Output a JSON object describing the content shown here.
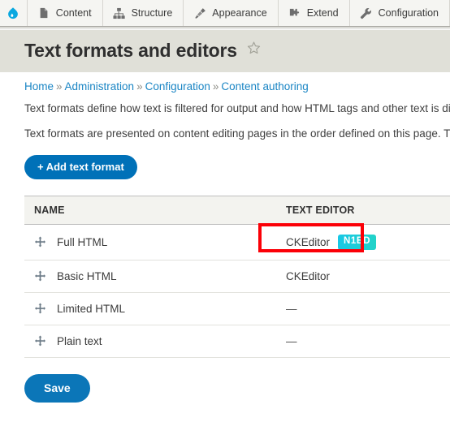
{
  "toolbar": {
    "home_icon": "drupal-droplet-logo",
    "tabs": [
      {
        "label": "Content",
        "icon": "document-icon"
      },
      {
        "label": "Structure",
        "icon": "hierarchy-icon"
      },
      {
        "label": "Appearance",
        "icon": "paintbrush-icon"
      },
      {
        "label": "Extend",
        "icon": "puzzle-piece-icon"
      },
      {
        "label": "Configuration",
        "icon": "wrench-icon"
      }
    ]
  },
  "header": {
    "title": "Text formats and editors",
    "bookmark_icon": "star-outline-icon"
  },
  "breadcrumb": {
    "separator": "»",
    "items": [
      {
        "label": "Home"
      },
      {
        "label": "Administration"
      },
      {
        "label": "Configuration"
      },
      {
        "label": "Content authoring"
      }
    ]
  },
  "intro": {
    "paragraph_1": "Text formats define how text is filtered for output and how HTML tags and other text is dis",
    "paragraph_2": "Text formats are presented on content editing pages in the order defined on this page. Th"
  },
  "actions": {
    "add_text_format": "+ Add text format",
    "save": "Save"
  },
  "table": {
    "columns": {
      "name": "NAME",
      "text_editor": "TEXT EDITOR"
    },
    "rows": [
      {
        "name": "Full HTML",
        "editor": "CKEditor",
        "badge": "N1ED",
        "handle_icon": "drag-move-icon"
      },
      {
        "name": "Basic HTML",
        "editor": "CKEditor",
        "badge": null,
        "handle_icon": "drag-move-icon"
      },
      {
        "name": "Limited HTML",
        "editor": "—",
        "badge": null,
        "handle_icon": "drag-move-icon"
      },
      {
        "name": "Plain text",
        "editor": "—",
        "badge": null,
        "handle_icon": "drag-move-icon"
      }
    ]
  },
  "annotation": {
    "highlight_color": "#fb0007",
    "target": "full-html-text-editor-cell"
  },
  "colors": {
    "accent_blue": "#0071b8",
    "link_blue": "#1a85c4",
    "badge_cyan": "#18c8e6",
    "badge_teal": "#23d3c8",
    "title_band": "#e0e0d8",
    "toolbar_bg": "#f5f5f2"
  }
}
